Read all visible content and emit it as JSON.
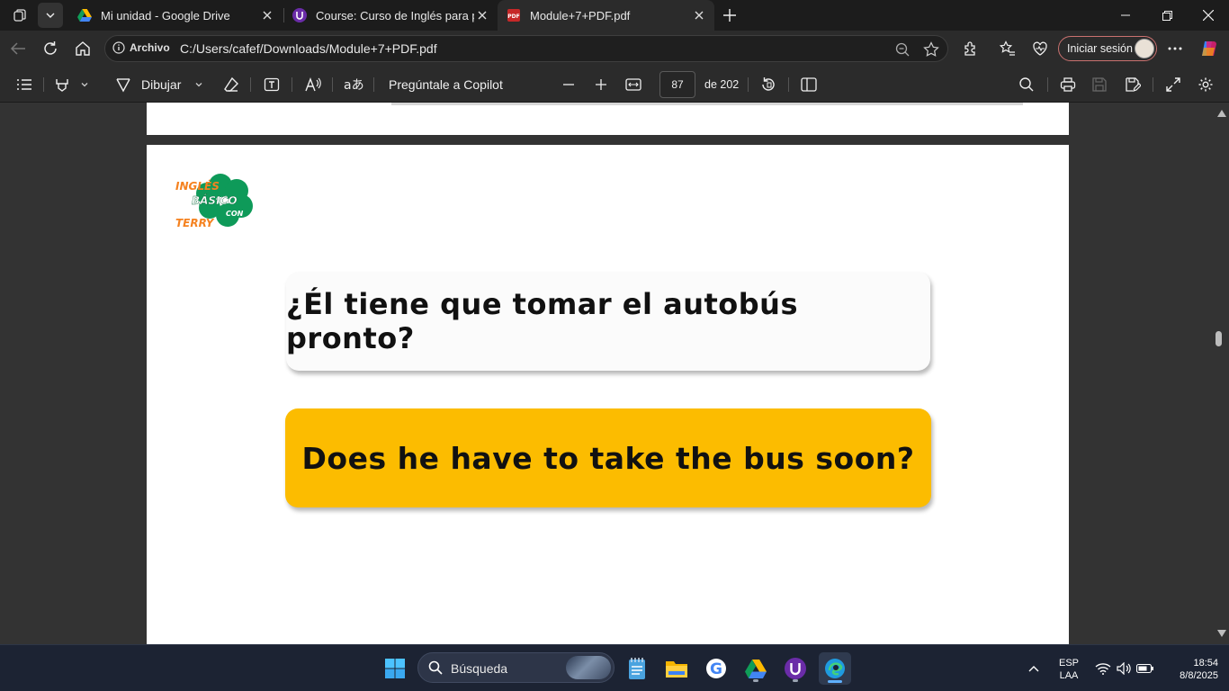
{
  "tabs": [
    {
      "title": "Mi unidad - Google Drive",
      "icon": "google-drive-icon",
      "active": false
    },
    {
      "title": "Course: Curso de Inglés para principiantes",
      "icon": "course-site-icon",
      "active": false
    },
    {
      "title": "Module+7+PDF.pdf",
      "icon": "pdf-icon",
      "active": true
    }
  ],
  "address_bar": {
    "info_label": "Archivo",
    "url": "C:/Users/cafef/Downloads/Module+7+PDF.pdf"
  },
  "profile": {
    "signin_label": "Iniciar sesión"
  },
  "pdf_toolbar": {
    "draw_label": "Dibujar",
    "copilot_label": "Pregúntale a Copilot",
    "page_current": "87",
    "page_total_label": "de 202"
  },
  "document": {
    "question_es": "¿Él tiene que tomar el autobús pronto?",
    "answer_en": "Does he have to take the bus soon?",
    "logo_text": [
      "INGLÉS",
      "BÁSICO",
      "CON",
      "TERRY"
    ],
    "accent_color": "#fcbc00",
    "logo_green": "#0e9a59",
    "logo_orange": "#f58220"
  },
  "taskbar": {
    "search_placeholder": "Búsqueda",
    "language": "ESP",
    "keyboard_layout": "LAA",
    "time": "18:54",
    "date": "8/8/2025"
  }
}
